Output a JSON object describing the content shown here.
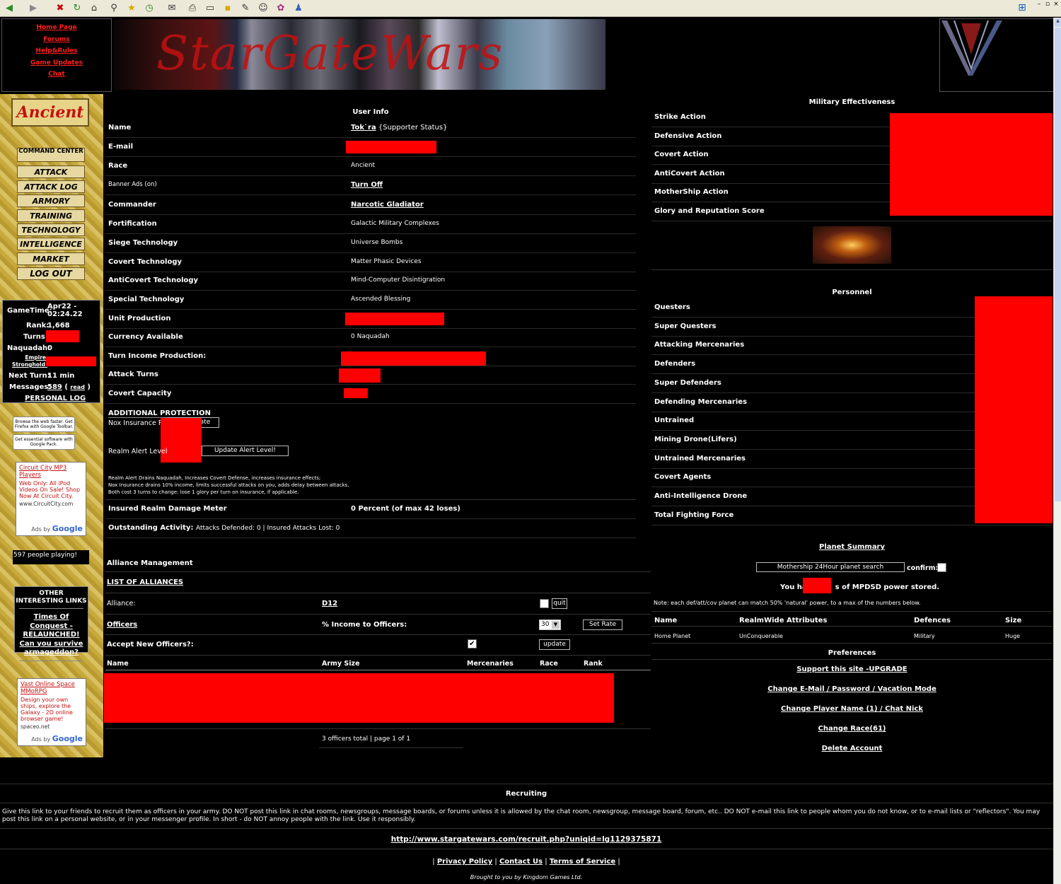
{
  "header": {
    "links": [
      "Home Page",
      "Forums",
      "Help&Rules",
      "Game Updates",
      "Chat"
    ],
    "banner_title": "StarGateWars"
  },
  "menu": {
    "race_title": "Ancient",
    "items": [
      "COMMAND CENTER",
      "ATTACK",
      "ATTACK LOG",
      "ARMORY",
      "TRAINING",
      "TECHNOLOGY",
      "INTELLIGENCE",
      "MARKET",
      "LOG OUT"
    ]
  },
  "stats": {
    "gametime_label": "GameTime:",
    "gametime_value": "Apr22 - 02:24.22",
    "rank_label": "Rank:",
    "rank_value": "1,668",
    "turns_label": "Turns:",
    "naquadah_label": "Naquadah:",
    "naquadah_value": "0",
    "empire_label": "Empire Stronghold:",
    "next_turn_label": "Next Turn:",
    "next_turn_value": "11 min",
    "messages_label": "Messages:",
    "messages_value": "589",
    "messages_read": "read",
    "personal_log": "PERSONAL LOG"
  },
  "ads": {
    "toolbar_ad": "Browse the web faster. Get Firefox with Google Toolbar.",
    "pack_ad": "Get essential software with Google Pack.",
    "ad1_title": "Circuit City MP3 Players",
    "ad1_text": "Web Only: All iPod Videos On Sale! Shop Now At Circuit City.",
    "ad1_url": "www.CircuitCity.com",
    "ads_by": "Ads by",
    "google": "Google",
    "players_playing": "597 people playing!",
    "ad2_title": "Vast Online Space MMoRPG",
    "ad2_text": "Design your own ships, explore the Galaxy - 2D online browser game!",
    "ad2_url": "spaceo.net"
  },
  "other_links": {
    "title": "OTHER INTERESTING LINKS",
    "items": [
      "Times Of Conquest - RELAUNCHED!",
      "Can you survive armageddon?"
    ]
  },
  "user_info": {
    "title": "User Info",
    "rows": [
      {
        "label": "Name",
        "value": "Tok`ra",
        "suffix": " {Supporter Status}"
      },
      {
        "label": "E-mail",
        "value": ""
      },
      {
        "label": "Race",
        "value": "Ancient"
      },
      {
        "label": "Banner Ads (on)",
        "value": "Turn Off"
      },
      {
        "label": "Commander",
        "value": "Narcotic Gladiator"
      },
      {
        "label": "Fortification",
        "value": "Galactic Military Complexes"
      },
      {
        "label": "Siege Technology",
        "value": "Universe Bombs"
      },
      {
        "label": "Covert Technology",
        "value": "Matter Phasic Devices"
      },
      {
        "label": "AntiCovert Technology",
        "value": "Mind-Computer Disintigration"
      },
      {
        "label": "Special Technology",
        "value": "Ascended Blessing"
      },
      {
        "label": "Unit Production",
        "value": ""
      },
      {
        "label": "Currency Available",
        "value": "0 Naquadah"
      },
      {
        "label": "Turn Income Production:",
        "value": ""
      },
      {
        "label": "Attack Turns",
        "value": ""
      },
      {
        "label": "Covert Capacity",
        "value": ""
      }
    ],
    "additional_protection": "ADDITIONAL PROTECTION",
    "nox_label": "Nox Insurance Po",
    "nox_button": "date",
    "realm_alert_label": "Realm Alert Level",
    "realm_alert_button": "Update Alert Level!",
    "notes": [
      "Realm Alert Drains Naquadah, Increases Covert Defense, increases insurance effects;",
      "Nox Insurance drains 10% income, limits successful attacks on you, adds delay between attacks.",
      "Both cost 3 turns to change: lose 1 glory per turn on insurance, if applicable."
    ],
    "damage_label": "Insured Realm Damage Meter",
    "damage_value": "0 Percent (of max 42 loses)",
    "outstanding_label": "Outstanding Activity:",
    "outstanding_value": "Attacks Defended: 0 | Insured Attacks Lost: 0"
  },
  "alliance": {
    "title": "Alliance Management",
    "list_link": "LIST OF ALLIANCES",
    "alliance_label": "Alliance:",
    "alliance_value": "D12",
    "quit_button": "quit",
    "officers_link": "Officers",
    "income_label": "% Income to Officers:",
    "income_value": "30",
    "set_rate_button": "Set Rate",
    "accept_label": "Accept New Officers?:",
    "update_button": "update",
    "columns": [
      "Name",
      "Army Size",
      "Mercenaries",
      "Race",
      "Rank"
    ],
    "footer": "3 officers total | page 1 of 1"
  },
  "military": {
    "title": "Military Effectiveness",
    "rows": [
      "Strike Action",
      "Defensive Action",
      "Covert Action",
      "AntiCovert Action",
      "MotherShip Action",
      "Glory and Reputation Score"
    ]
  },
  "personnel": {
    "title": "Personnel",
    "rows": [
      "Questers",
      "Super Questers",
      "Attacking Mercenaries",
      "Defenders",
      "Super Defenders",
      "Defending Mercenaries",
      "Untrained",
      "Mining Drone(Lifers)",
      "Untrained Mercenaries",
      "Covert Agents",
      "Anti-Intelligence Drone",
      "Total Fighting Force"
    ]
  },
  "planet": {
    "title": "Planet Summary",
    "search_button": "Mothership 24Hour planet search",
    "confirm_label": "confirm:",
    "power_prefix": "You ha",
    "power_suffix": "s of MPDSD power stored.",
    "note": "Note: each def/att/cov planet can match 50% 'natural' power, to a max of the numbers below.",
    "columns": [
      "Name",
      "RealmWide Attributes",
      "Defences",
      "Size"
    ],
    "row": [
      "Home Planet",
      "UnConquerable",
      "Military",
      "Huge"
    ]
  },
  "preferences": {
    "title": "Preferences",
    "links": [
      "Support this site -UPGRADE",
      "Change E-Mail / Password / Vacation Mode",
      "Change Player Name (1) / Chat Nick",
      "Change Race(61)",
      "Delete Account"
    ]
  },
  "recruiting": {
    "title": "Recruiting",
    "text": "Give this link to your friends to recruit them as officers in your army. DO NOT post this link in chat rooms, newsgroups, message boards, or forums unless it is allowed by the chat room, newsgroup, message board, forum, etc.. DO NOT e-mail this link to people whom you do not know, or to e-mail lists or \"reflectors\". You may post this link on a personal website, or in your messenger profile. In short - do NOT annoy people with the link. Use it responsibly.",
    "url": "http://www.stargatewars.com/recruit.php?uniqid=lg1129375871"
  },
  "footer": {
    "links": [
      "Privacy Policy",
      "Contact Us",
      "Terms of Service"
    ],
    "credit": "Brought to you by Kingdom Games Ltd."
  }
}
